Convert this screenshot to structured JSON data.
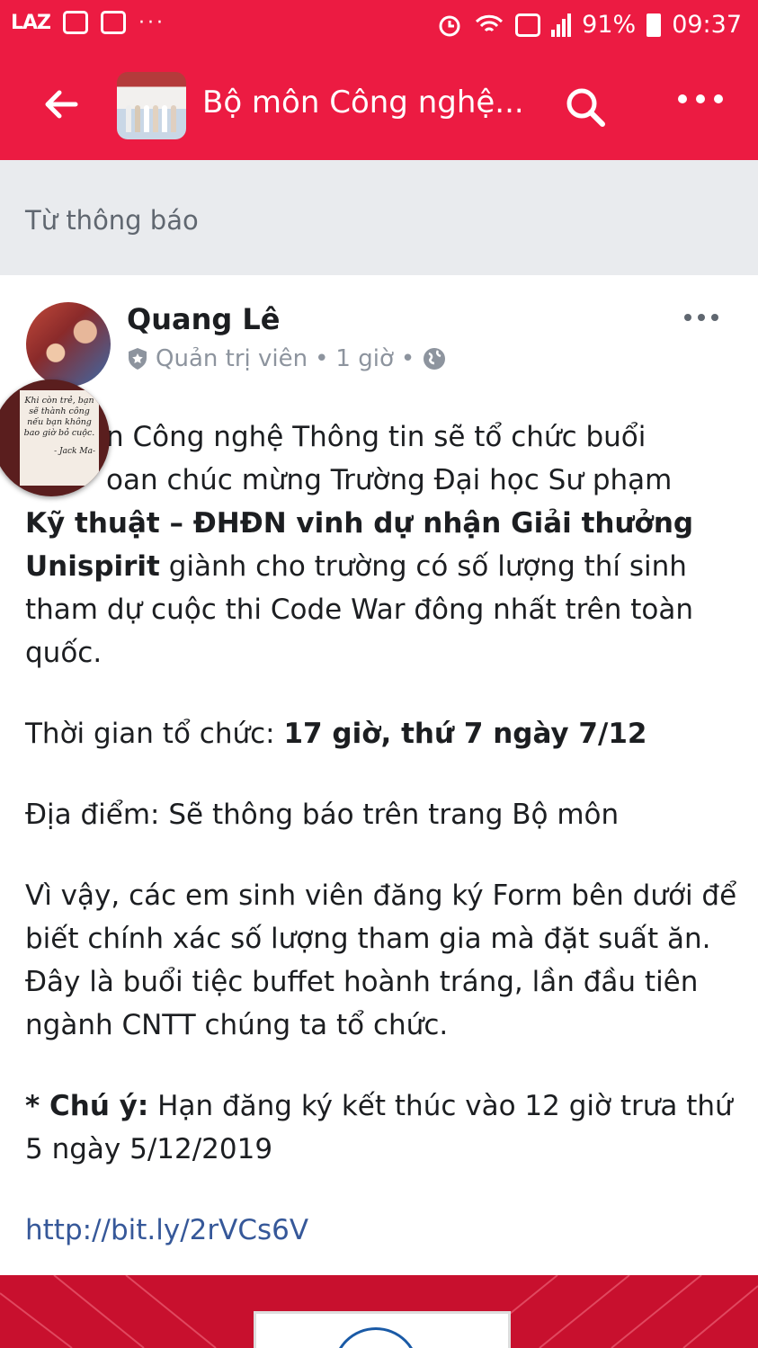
{
  "status_bar": {
    "app_label": "LAZ",
    "dots": "···",
    "battery": "91%",
    "time": "09:37"
  },
  "app_bar": {
    "title": "Bộ môn Công nghệ..."
  },
  "notice": {
    "label": "Từ thông báo"
  },
  "post": {
    "author": "Quang Lê",
    "role": "Quản trị viên",
    "sep1": "•",
    "time": "1 giờ",
    "sep2": "•",
    "bubble_quote": "Khi còn trẻ, bạn sẽ thành công nếu bạn không bao giờ bỏ cuộc.",
    "bubble_author": "- Jack Ma-",
    "p1_line1": "n Công nghệ Thông tin sẽ tổ chức buổi",
    "p1_line2": "oan chúc mừng Trường Đại học Sư phạm",
    "p1_bold": "Kỹ thuật – ĐHĐN vinh dự nhận Giải thưởng Unispirit",
    "p1_rest": " giành cho trường có số lượng thí sinh tham dự cuộc thi Code War đông nhất trên toàn quốc.",
    "p2_label": "Thời gian tổ chức: ",
    "p2_bold": "17 giờ, thứ 7 ngày 7/12",
    "p3": "Địa điểm: Sẽ thông báo trên trang Bộ môn",
    "p4": "Vì vậy, các em sinh viên đăng ký Form bên dưới để biết chính xác số lượng tham gia mà đặt suất ăn. Đây là buổi tiệc buffet hoành tráng, lần đầu tiên ngành CNTT chúng ta tổ chức.",
    "p5_bold": "* Chú ý:",
    "p5_rest": " Hạn đăng ký kết thúc vào 12 giờ trưa thứ 5 ngày 5/12/2019",
    "link": "http://bit.ly/2rVCs6V"
  },
  "colors": {
    "brand_red": "#ec1b42",
    "link": "#365899",
    "band": "#e9ebee"
  },
  "icons": [
    "back-arrow-icon",
    "search-icon",
    "more-icon",
    "shield-icon",
    "globe-icon",
    "alarm-icon",
    "wifi-icon",
    "signal-icon",
    "battery-icon"
  ]
}
